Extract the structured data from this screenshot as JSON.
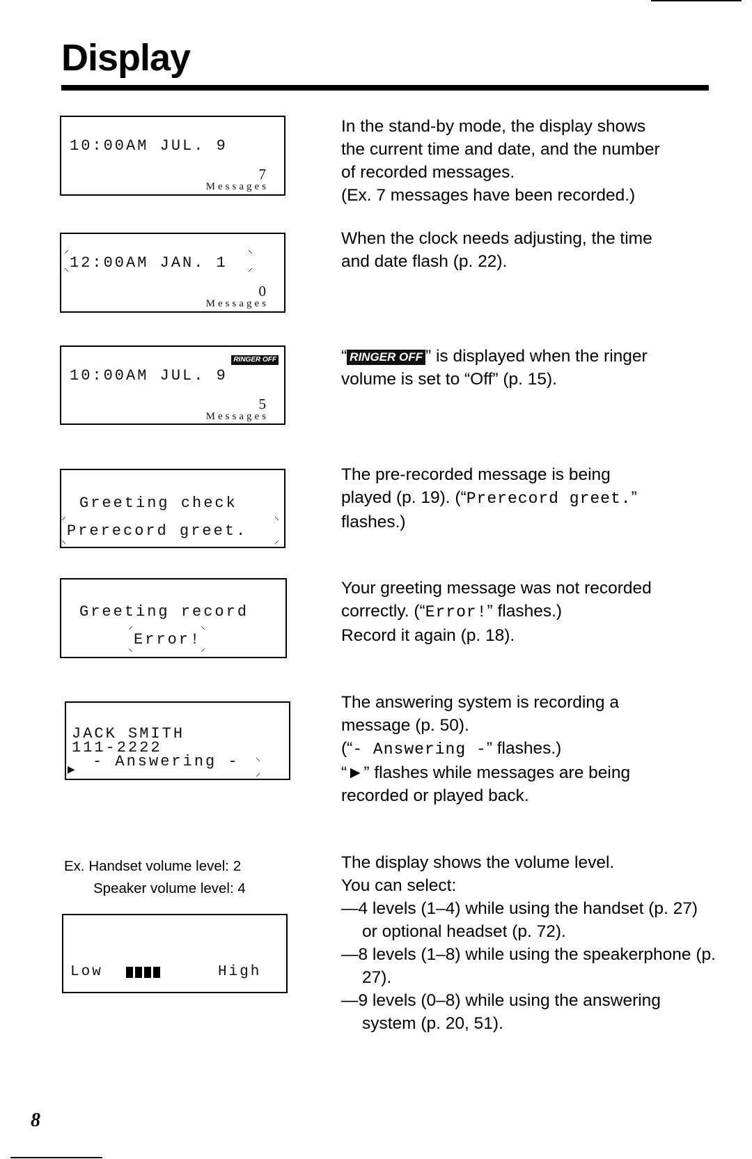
{
  "page": {
    "title": "Display",
    "page_number": "8"
  },
  "displays": [
    {
      "id": "standby",
      "line1": "10:00AM JUL. 9",
      "count": "7",
      "messages_label": "Messages"
    },
    {
      "id": "clock-adjust",
      "line1": "12:00AM JAN. 1",
      "count": "0",
      "messages_label": "Messages"
    },
    {
      "id": "ringer-off",
      "badge": "RINGER OFF",
      "line1": "10:00AM JUL. 9",
      "count": "5",
      "messages_label": "Messages"
    },
    {
      "id": "greeting-check",
      "line1": "Greeting check",
      "line2": "Prerecord greet."
    },
    {
      "id": "greeting-error",
      "line1": "Greeting record",
      "line2": "Error!"
    },
    {
      "id": "answering",
      "line1": "JACK SMITH",
      "line2": "111-2222",
      "line3": "- Answering -"
    },
    {
      "id": "volume",
      "caption_line1": "Ex. Handset volume level: 2",
      "caption_line2": "Speaker volume level: 4",
      "low_label": "Low",
      "high_label": "High",
      "bars_shown": 4
    }
  ],
  "descriptions": {
    "standby": [
      "In the stand-by mode, the display shows",
      "the current time and date, and the number",
      "of recorded messages.",
      "(Ex. 7 messages have been recorded.)"
    ],
    "clock_adjust": [
      "When the clock needs adjusting, the time",
      "and date flash (p. 22)."
    ],
    "ringer_off": {
      "open_quote": "“",
      "badge": "RINGER OFF",
      "after_badge": "” is displayed when the ringer",
      "line2": "volume is set to “Off” (p. 15)."
    },
    "greeting_check": {
      "line1": "The pre-recorded message is being",
      "line2_prefix": "played (p. 19). (“",
      "line2_mono": "Prerecord greet.",
      "line2_suffix": "”",
      "line3": "flashes.)"
    },
    "greeting_error": {
      "line1": "Your greeting message was not recorded",
      "line2_prefix": "correctly. (“",
      "line2_mono": "Error!",
      "line2_suffix": "” flashes.)",
      "line3": "Record it again (p. 18)."
    },
    "answering": {
      "line1": "The answering system is recording a",
      "line2": "message (p. 50).",
      "line3_prefix": "(“",
      "line3_mono": "- Answering -",
      "line3_suffix": "” flashes.)",
      "line4": "“►” flashes while messages are being",
      "line5": "recorded or played back."
    },
    "volume": {
      "line1": "The display shows the volume level.",
      "line2": "You can select:",
      "items": [
        "—4 levels (1–4) while using the handset (p. 27) or optional headset (p. 72).",
        "—8 levels (1–8) while using the speakerphone (p. 27).",
        "—9 levels (0–8) while using the answering system (p. 20, 51)."
      ]
    }
  }
}
